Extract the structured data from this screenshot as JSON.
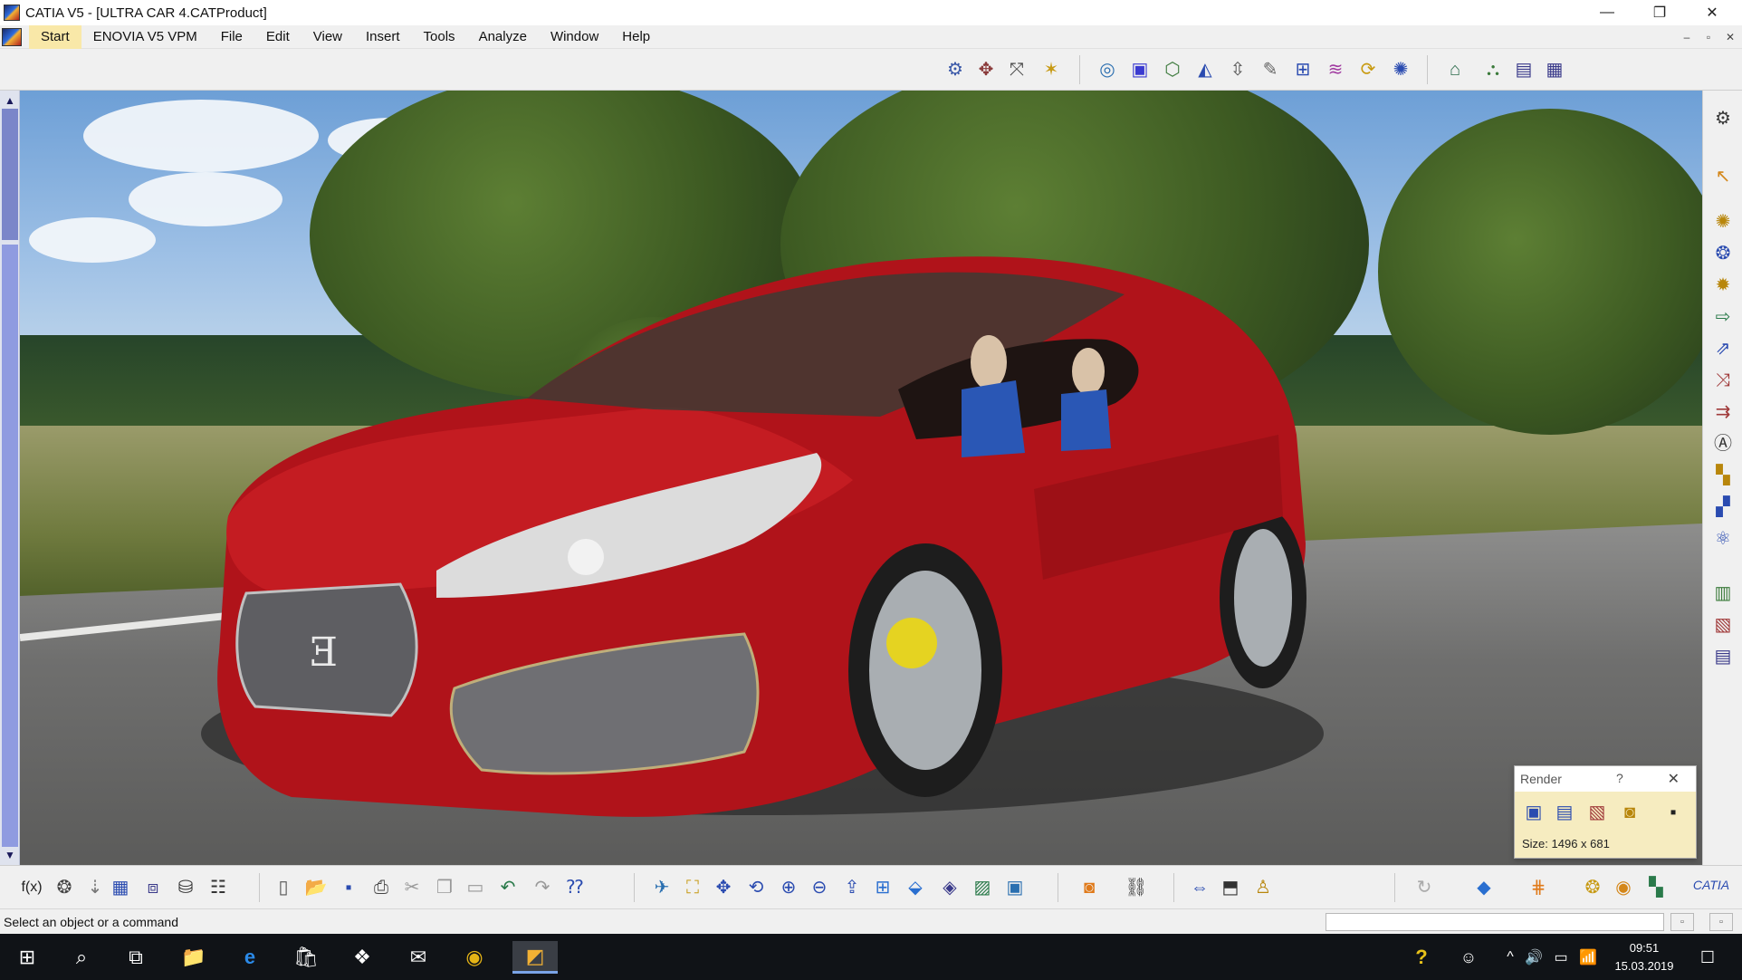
{
  "window": {
    "title": "CATIA V5 - [ULTRA CAR 4.CATProduct]",
    "controls": [
      "minimize-icon",
      "restore-icon",
      "close-icon"
    ],
    "minimize_glyph": "—",
    "restore_glyph": "❐",
    "close_glyph": "✕"
  },
  "menu": {
    "items": [
      "Start",
      "ENOVIA V5 VPM",
      "File",
      "Edit",
      "View",
      "Insert",
      "Tools",
      "Analyze",
      "Window",
      "Help"
    ],
    "mdi_min": "–",
    "mdi_restore": "▫",
    "mdi_close": "✕"
  },
  "scroll": {
    "up": "▲",
    "down": "▼"
  },
  "render_panel": {
    "title": "Render",
    "help": "?",
    "close": "✕",
    "size_label": "Size: 1496 x 681"
  },
  "status": {
    "prompt": "Select an object or a command",
    "btn1": "▫",
    "btn2": "▫"
  },
  "taskbar": {
    "time": "09:51",
    "date": "15.03.2019",
    "start_glyph": "⊞",
    "search_glyph": "⌕",
    "taskview_glyph": "⧉",
    "explorer_glyph": "📁",
    "edge_glyph": "e",
    "store_glyph": "🛍",
    "dropbox_glyph": "❖",
    "mail_glyph": "✉",
    "chrome_glyph": "◉",
    "catia_glyph": "◩",
    "help_glyph": "?",
    "people_glyph": "☺",
    "tray_up_glyph": "^",
    "volume_glyph": "🔊",
    "battery_glyph": "▭",
    "network_glyph": "📶",
    "notifications_glyph": "☐"
  },
  "colors": {
    "accent": "#f9e8a8",
    "render_body": "#f6ecc0",
    "car_red": "#b0131a",
    "scroll_track": "#8f9be0"
  }
}
